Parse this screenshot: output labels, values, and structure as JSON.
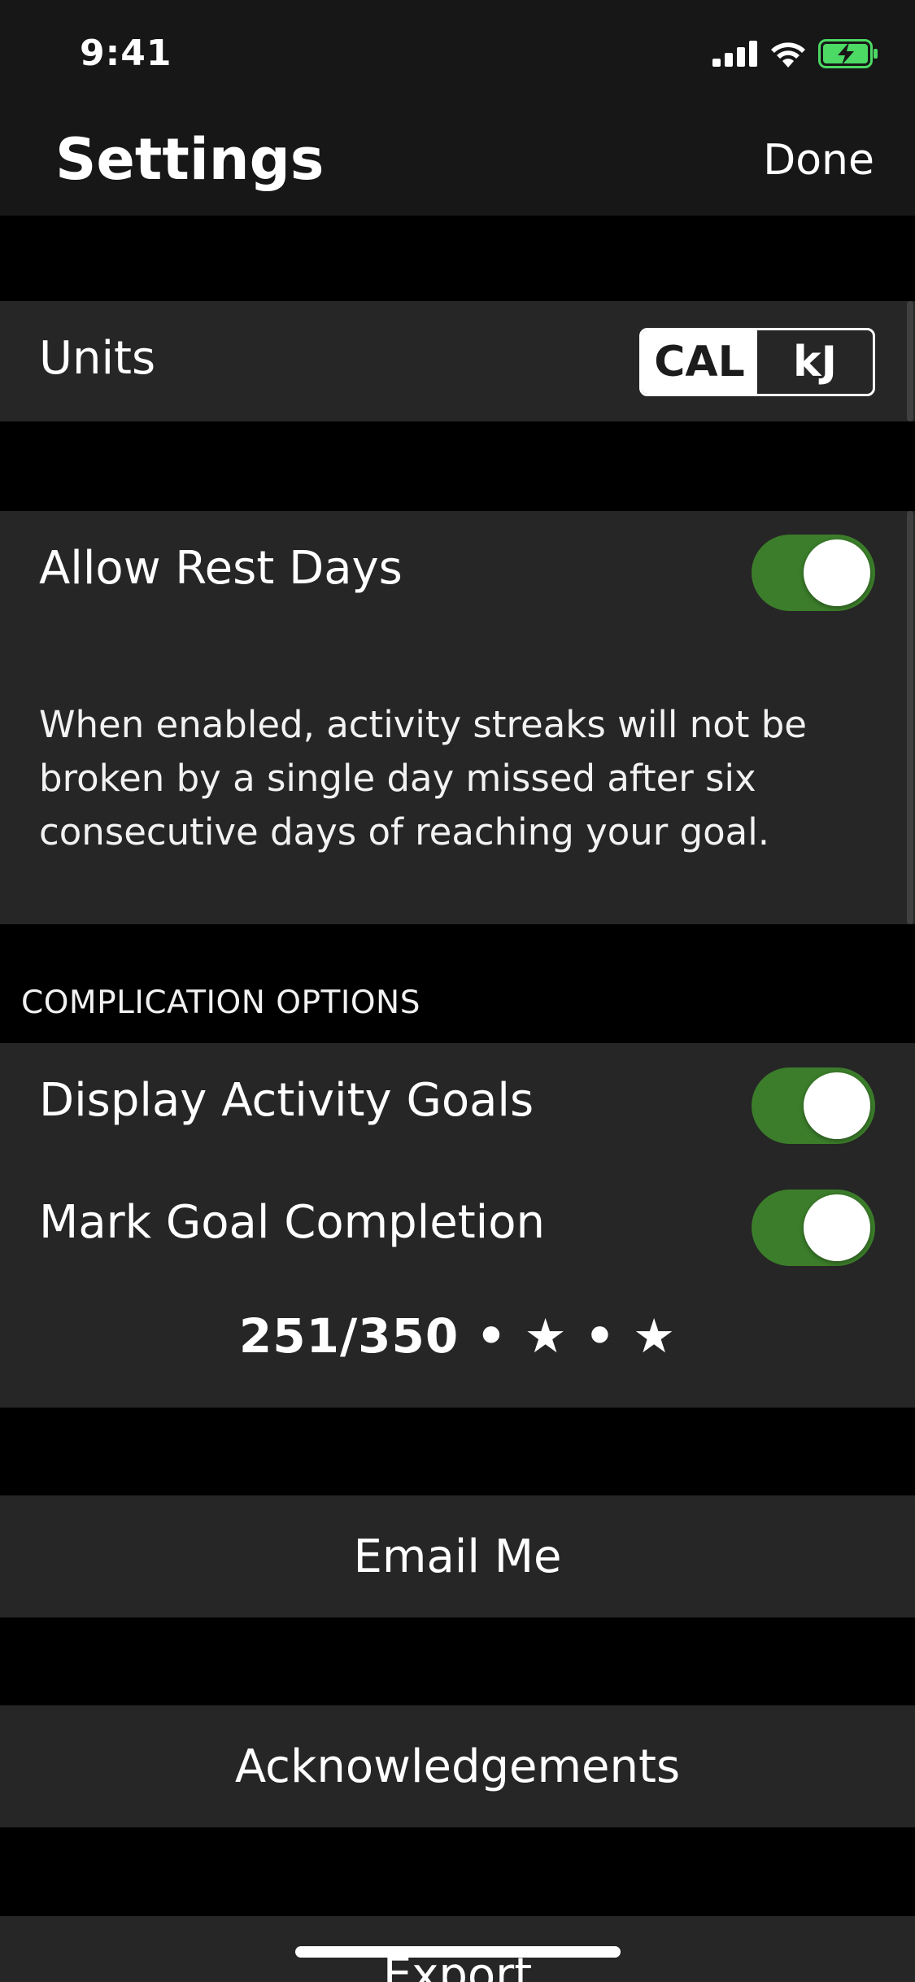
{
  "status_bar": {
    "time": "9:41",
    "icons": [
      "signal-icon",
      "wifi-icon",
      "battery-charging-icon"
    ],
    "battery_color": "#4cd964"
  },
  "nav": {
    "title": "Settings",
    "done_label": "Done"
  },
  "units": {
    "label": "Units",
    "options": [
      "CAL",
      "kJ"
    ],
    "selected": "CAL"
  },
  "rest_days": {
    "label": "Allow Rest Days",
    "enabled": true,
    "description": "When enabled, activity streaks will not be broken by a single day missed after six consecutive days of reaching your goal."
  },
  "complication": {
    "header": "COMPLICATION OPTIONS",
    "display_goals_label": "Display Activity Goals",
    "display_goals_enabled": true,
    "mark_completion_label": "Mark Goal Completion",
    "mark_completion_enabled": true,
    "preview": "251/350 • ★ • ★"
  },
  "actions": {
    "email": "Email Me",
    "acknowledgements": "Acknowledgements",
    "export": "Export"
  },
  "colors": {
    "toggle_on": "#3b7d2a",
    "cell_background": "#262626",
    "bar_background": "#171717"
  }
}
